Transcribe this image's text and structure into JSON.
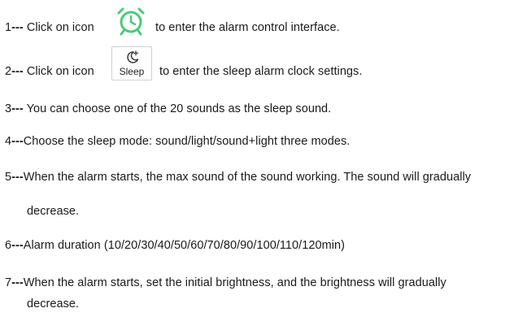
{
  "steps": [
    {
      "num": "1",
      "dash": "---",
      "before": " Click on icon",
      "after": "to enter the alarm control interface."
    },
    {
      "num": "2",
      "dash": "---",
      "before": " Click on icon",
      "after": "to enter the sleep alarm clock settings."
    },
    {
      "num": "3",
      "dash": "---",
      "text": " You can choose one of the 20 sounds as the sleep sound."
    },
    {
      "num": "4",
      "dash": "---",
      "text": "Choose the sleep mode: sound/light/sound+light three modes."
    },
    {
      "num": "5",
      "dash": "---",
      "text": "When the alarm starts, the max sound of the sound working. The sound will gradually",
      "cont": "decrease."
    },
    {
      "num": "6",
      "dash": "---",
      "text": "Alarm duration  (10/20/30/40/50/60/70/80/90/100/110/120min)"
    },
    {
      "num": "7",
      "dash": "---",
      "text": "When the alarm starts, set the initial brightness, and the brightness will gradually",
      "cont": "decrease."
    }
  ],
  "icons": {
    "alarm": {
      "name": "alarm-clock-icon",
      "color": "#4cc97a"
    },
    "sleep": {
      "name": "sleep-moon-icon",
      "label": "Sleep"
    }
  }
}
